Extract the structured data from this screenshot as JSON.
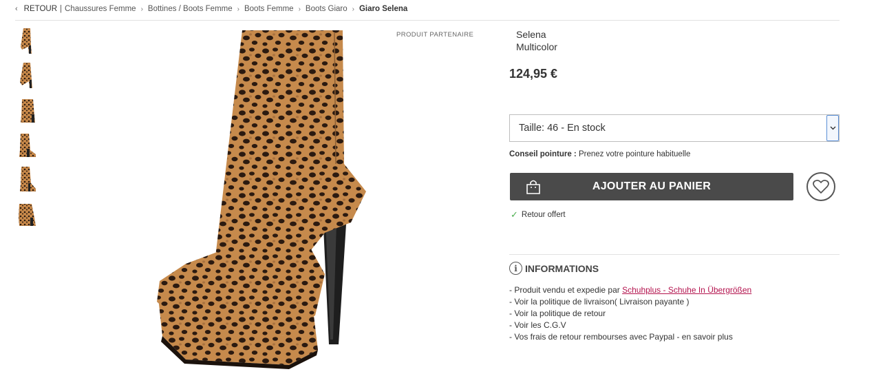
{
  "breadcrumb": {
    "back_label": "RETOUR",
    "items": [
      "Chaussures Femme",
      "Bottines / Boots Femme",
      "Boots Femme",
      "Boots Giaro"
    ],
    "current": "Giaro Selena"
  },
  "gallery": {
    "thumbnail_count": 6,
    "main_image": "leopard-print-platform-high-heel-ankle-boot"
  },
  "partner_tag": "PRODUIT PARTENAIRE",
  "product": {
    "name": "Selena",
    "color": "Multicolor",
    "price": "124,95 €"
  },
  "size_select": {
    "value": "Taille: 46 - En stock"
  },
  "advice": {
    "label": "Conseil pointure :",
    "text": "Prenez votre pointure habituelle"
  },
  "cart_button": {
    "label": "AJOUTER AU PANIER"
  },
  "return_offer": "Retour offert",
  "informations": {
    "title": "INFORMATIONS",
    "sold_prefix": "- Produit vendu et expedie par ",
    "seller": "Schuhplus - Schuhe In Übergrößen",
    "lines": [
      "- Voir la politique de livraison( Livraison payante )",
      "- Voir la politique de retour",
      "- Voir les C.G.V",
      "- Vos frais de retour rembourses avec Paypal - en savoir plus"
    ]
  },
  "colors": {
    "cart_bg": "#4a4a4a",
    "seller_link": "#b3124d",
    "check_green": "#4caf50",
    "select_arrow_border": "#5b8fd6"
  }
}
